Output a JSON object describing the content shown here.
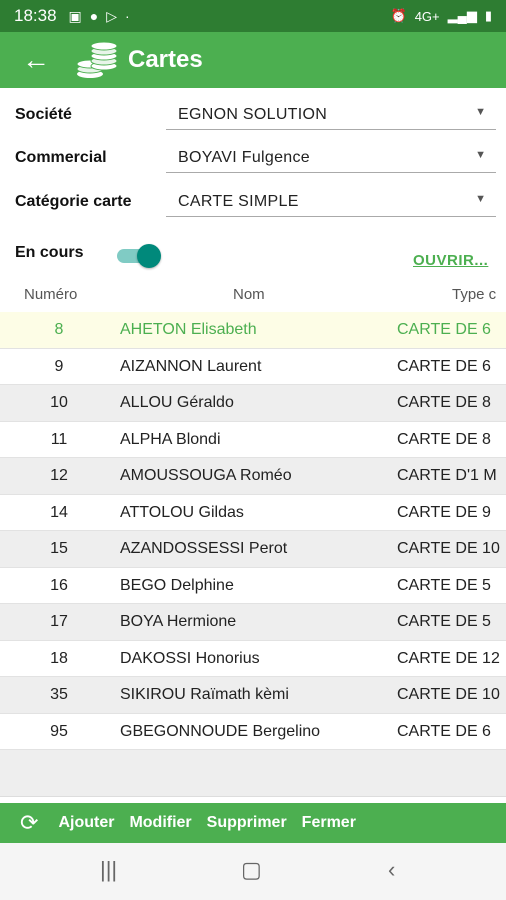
{
  "status_bar": {
    "time": "18:38",
    "network": "4G+"
  },
  "app_bar": {
    "title": "Cartes"
  },
  "form": {
    "societe": {
      "label": "Société",
      "value": "EGNON SOLUTION"
    },
    "commercial": {
      "label": "Commercial",
      "value": "BOYAVI Fulgence"
    },
    "categorie": {
      "label": "Catégorie carte",
      "value": "CARTE SIMPLE"
    },
    "en_cours": {
      "label": "En cours",
      "on": true
    },
    "open_link": "OUVRIR..."
  },
  "table": {
    "headers": {
      "numero": "Numéro",
      "nom": "Nom",
      "type": "Type c"
    },
    "rows": [
      {
        "numero": "8",
        "nom": "AHETON Elisabeth",
        "type": "CARTE DE 6"
      },
      {
        "numero": "9",
        "nom": "AIZANNON Laurent",
        "type": "CARTE DE 6"
      },
      {
        "numero": "10",
        "nom": "ALLOU Géraldo",
        "type": "CARTE DE 8"
      },
      {
        "numero": "11",
        "nom": "ALPHA Blondi",
        "type": "CARTE DE 8"
      },
      {
        "numero": "12",
        "nom": "AMOUSSOUGA Roméo",
        "type": "CARTE D'1 M"
      },
      {
        "numero": "14",
        "nom": "ATTOLOU Gildas",
        "type": "CARTE DE 9"
      },
      {
        "numero": "15",
        "nom": "AZANDOSSESSI Perot",
        "type": "CARTE DE 10"
      },
      {
        "numero": "16",
        "nom": "BEGO Delphine",
        "type": "CARTE DE 5"
      },
      {
        "numero": "17",
        "nom": "BOYA Hermione",
        "type": "CARTE DE 5"
      },
      {
        "numero": "18",
        "nom": "DAKOSSI Honorius",
        "type": "CARTE DE 12"
      },
      {
        "numero": "35",
        "nom": "SIKIROU Raïmath kèmi",
        "type": "CARTE DE 10"
      },
      {
        "numero": "95",
        "nom": "GBEGONNOUDE Bergelino",
        "type": "CARTE DE 6"
      }
    ]
  },
  "actions": {
    "add": "Ajouter",
    "edit": "Modifier",
    "delete": "Supprimer",
    "close": "Fermer"
  },
  "colors": {
    "status_bar": "#2e7d32",
    "primary": "#4caf50",
    "switch_on": "#00897b",
    "selected_row": "#fdfde6"
  }
}
